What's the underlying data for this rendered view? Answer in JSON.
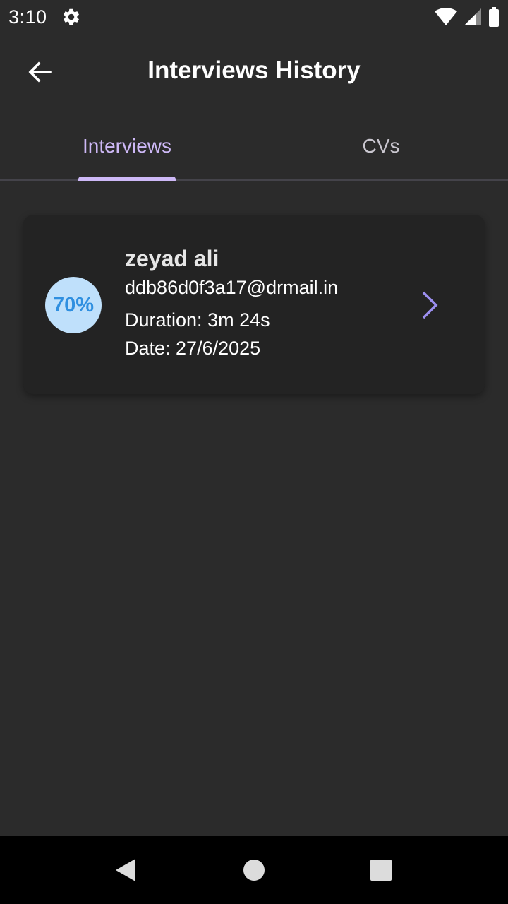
{
  "status_bar": {
    "time": "3:10",
    "icons": [
      "gear-icon",
      "wifi-icon",
      "signal-icon",
      "battery-icon"
    ]
  },
  "header": {
    "title": "Interviews History",
    "back_icon": "arrow-left-icon"
  },
  "tabs": [
    {
      "label": "Interviews",
      "active": true
    },
    {
      "label": "CVs",
      "active": false
    }
  ],
  "interviews": [
    {
      "score": "70%",
      "name": "zeyad ali",
      "email": "ddb86d0f3a17@drmail.in",
      "duration": "Duration: 3m 24s",
      "date": "Date: 27/6/2025"
    }
  ],
  "nav_bar": {
    "buttons": [
      "back-triangle-icon",
      "home-circle-icon",
      "recents-square-icon"
    ]
  },
  "colors": {
    "background": "#2b2b2b",
    "card": "#232323",
    "accent": "#cdb8f6",
    "score_bg": "#bfe0fb",
    "score_text": "#2f8fe0",
    "chevron": "#9c8ff0"
  }
}
